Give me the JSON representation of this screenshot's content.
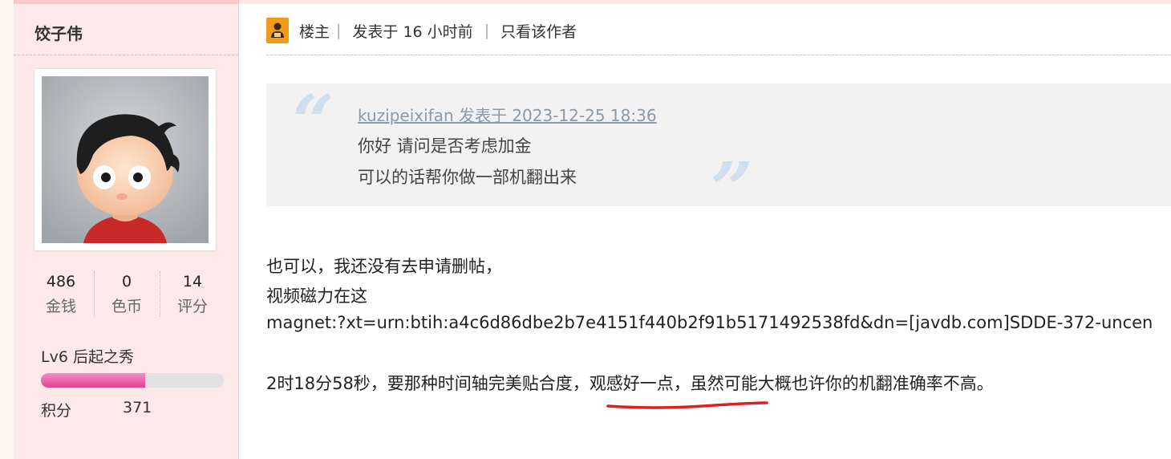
{
  "user": {
    "name": "饺子伟",
    "stats": [
      {
        "value": "486",
        "label": "金钱"
      },
      {
        "value": "0",
        "label": "色币"
      },
      {
        "value": "14",
        "label": "评分"
      }
    ],
    "level": "Lv6 后起之秀",
    "level_progress": 0.57,
    "points_label": "积分",
    "points_value": "371"
  },
  "post": {
    "owner_label": "楼主",
    "separator": "|",
    "posted_time": "发表于 16 小时前",
    "author_only": "只看该作者",
    "quote": {
      "author_line": "kuzipeixifan 发表于 2023-12-25 18:36",
      "lines": [
        "你好  请问是否考虑加金",
        "可以的话帮你做一部机翻出来"
      ]
    },
    "body": [
      "也可以，我还没有去申请删帖，",
      "视频磁力在这",
      "magnet:?xt=urn:btih:a4c6d86dbe2b7e4151f440b2f91b5171492538fd&dn=[javdb.com]SDDE-372-uncen",
      "2时18分58秒，要那种时间轴完美贴合度，观感好一点，虽然可能大概也许你的机翻准确率不高。"
    ]
  },
  "colors": {
    "sidebar_bg": "#fee9ea",
    "progress_fill": "#e0428f",
    "owner_icon": "#f39a1a",
    "quote_mark": "#cfdfee",
    "annotation": "#e02020"
  },
  "icons": [
    "owner-badge-icon",
    "quote-open-icon",
    "quote-close-icon"
  ]
}
